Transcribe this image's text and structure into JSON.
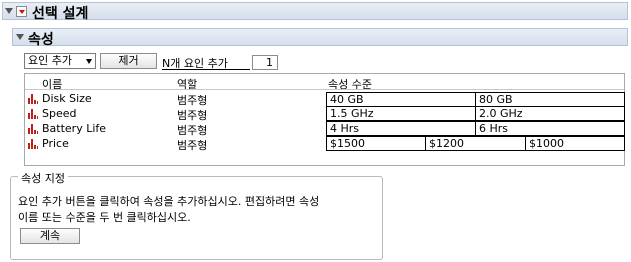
{
  "outline": {
    "title": "선택 설계"
  },
  "section": {
    "title": "속성"
  },
  "toolbar": {
    "add_factor_select": "요인 추가",
    "remove_button": "제거",
    "n_factors_label": "N개 요인 추가",
    "n_factors_value": "1"
  },
  "table": {
    "headers": [
      "이름",
      "역할",
      "속성 수준"
    ],
    "rows": [
      {
        "name": "Disk Size",
        "role": "범주형",
        "levels": [
          "40 GB",
          "80 GB"
        ]
      },
      {
        "name": "Speed",
        "role": "범주형",
        "levels": [
          "1.5 GHz",
          "2.0 GHz"
        ]
      },
      {
        "name": "Battery Life",
        "role": "범주형",
        "levels": [
          "4 Hrs",
          "6 Hrs"
        ]
      },
      {
        "name": "Price",
        "role": "범주형",
        "levels": [
          "$1500",
          "$1200",
          "$1000"
        ]
      }
    ]
  },
  "specify": {
    "title": "속성 지정",
    "line1": "요인 추가 버튼을 클릭하여 속성을 추가하십시오. 편집하려면 속성",
    "line2": "이름 또는 수준을 두 번 클릭하십시오.",
    "continue_button": "계속"
  },
  "colors": {
    "header_bg": "#dfe6f1",
    "icon_red": "#c0201a"
  }
}
